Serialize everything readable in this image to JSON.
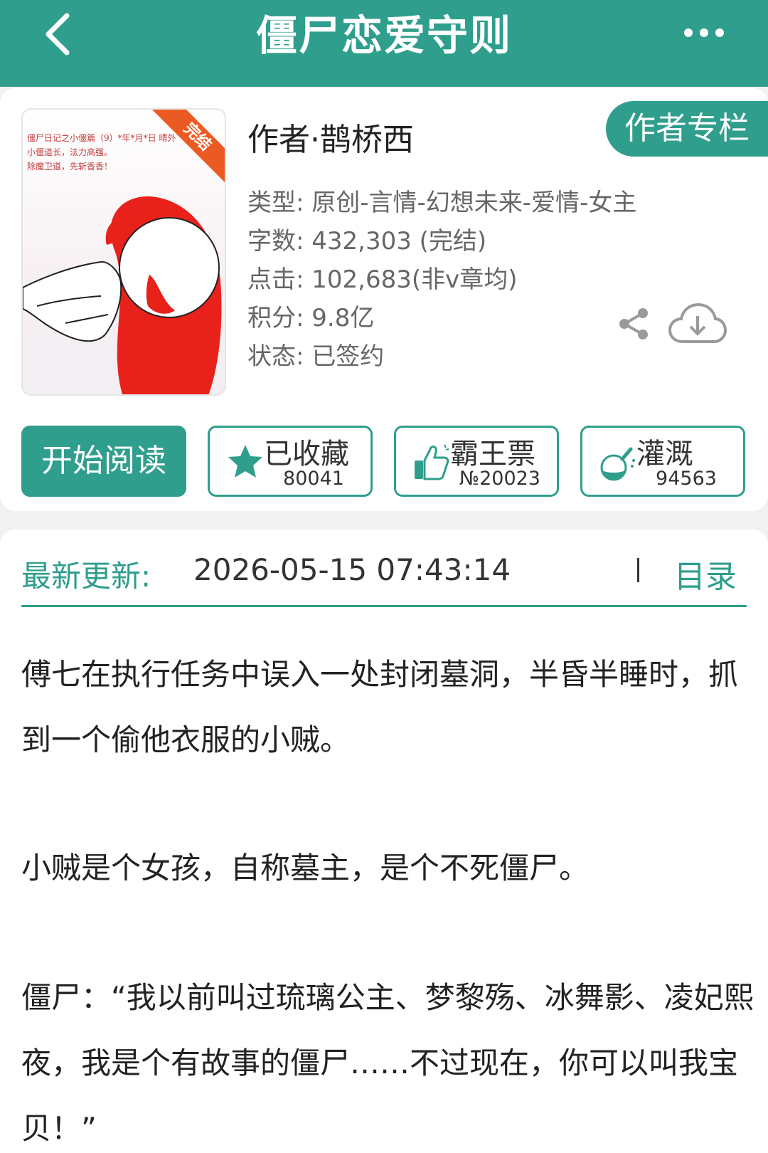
{
  "header": {
    "title": "僵尸恋爱守则",
    "back_icon": "chevron-left-icon",
    "more_icon": "more-dots-icon"
  },
  "book": {
    "cover_text": "僵尸日记之小僵篇（9）*年*月*日 晴外\n小僵道长，法力高强。\n除魔卫道，先斩香香！",
    "cover_badge": "完结",
    "author": "作者·鹊桥西",
    "author_column_button": "作者专栏",
    "info": {
      "type": "类型: 原创-言情-幻想未来-爱情-女主",
      "words": "字数: 432,303 (完结)",
      "clicks": "点击: 102,683(非v章均)",
      "score": "积分: 9.8亿",
      "status": "状态: 已签约"
    }
  },
  "actions": {
    "read_label": "开始阅读",
    "favorite": {
      "label": "已收藏",
      "count": "80041",
      "icon": "star-icon"
    },
    "vote": {
      "label": "霸王票",
      "count": "№20023",
      "icon": "thumbs-up-icon"
    },
    "water": {
      "label": "灌溉",
      "count": "94563",
      "icon": "watering-flask-icon"
    }
  },
  "update": {
    "label": "最新更新:",
    "time": "2026-05-15 07:43:14",
    "toc_label": "目录"
  },
  "summary": {
    "p1": "傅七在执行任务中误入一处封闭墓洞，半昏半睡时，抓到一个偷他衣服的小贼。",
    "p2": "小贼是个女孩，自称墓主，是个不死僵尸。",
    "p3": "僵尸：“我以前叫过琉璃公主、梦黎殇、冰舞影、凌妃熙夜，我是个有故事的僵尸……不过现在，你可以叫我宝贝！”"
  },
  "colors": {
    "accent": "#2f9e8d",
    "ribbon": "#ec5a24",
    "cover_red": "#e8211b"
  }
}
